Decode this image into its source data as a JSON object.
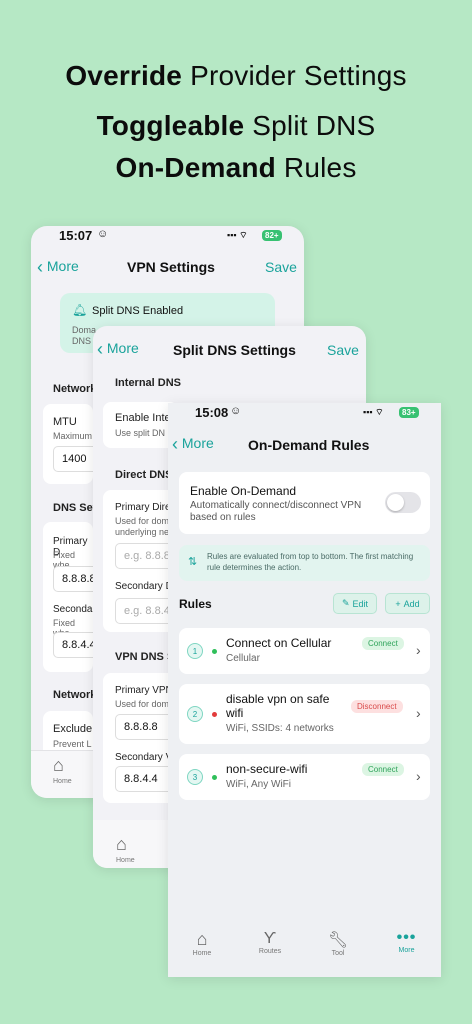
{
  "headline": {
    "line1_bold": "Override",
    "line1_rest": " Provider Settings",
    "line2_bold": "Toggleable",
    "line2_rest": " Split DNS",
    "line3_bold": "On-Demand",
    "line3_rest": " Rules"
  },
  "screen1": {
    "time": "15:07",
    "battery": "82+",
    "back": "More",
    "title": "VPN Settings",
    "action": "Save",
    "toast": {
      "text": "Split DNS Enabled",
      "sub1": "Doma",
      "sub2": "DNS"
    },
    "network_h": "Network",
    "mtu_label": "MTU",
    "mtu_sub": "Maximum",
    "mtu_value": "1400",
    "dns_h": "DNS Set",
    "primary_label": "Primary D",
    "primary_sub": "Fixed whe",
    "primary_value": "8.8.8.8",
    "secondary_label": "Seconda",
    "secondary_sub": "Fixed whe",
    "secondary_value": "8.8.4.4",
    "network2_h": "Network",
    "exclude_label": "Exclude",
    "exclude_sub": "Prevent L",
    "tab_home": "Home"
  },
  "screen2": {
    "back": "More",
    "title": "Split DNS Settings",
    "action": "Save",
    "internal_h": "Internal DNS",
    "enable_label": "Enable Inte",
    "enable_sub": "Use split DN",
    "direct_h": "Direct DNS",
    "primary_label": "Primary Dire",
    "primary_sub1": "Used for dom",
    "primary_sub2": "underlying ne",
    "primary_ph": "e.g. 8.8.8",
    "secondary_label": "Secondary D",
    "secondary_ph": "e.g. 8.8.4",
    "vpn_h": "VPN DNS S",
    "vpn_primary_label": "Primary VPN",
    "vpn_primary_sub": "Used for dom",
    "vpn_primary_value": "8.8.8.8",
    "vpn_secondary_label": "Secondary V",
    "vpn_secondary_value": "8.8.4.4",
    "tab_home": "Home"
  },
  "screen3": {
    "time": "15:08",
    "battery": "83+",
    "back": "More",
    "title": "On-Demand Rules",
    "enable_title": "Enable On-Demand",
    "enable_sub": "Automatically connect/disconnect VPN based on rules",
    "info": "Rules are evaluated from top to bottom. The first matching rule determines the action.",
    "rules_h": "Rules",
    "edit_label": "Edit",
    "add_label": "Add",
    "rules": [
      {
        "num": "1",
        "title": "Connect on Cellular",
        "sub": "Cellular",
        "action": "Connect",
        "dot_color": "#2fbf5a"
      },
      {
        "num": "2",
        "title": "disable vpn on safe wifi",
        "sub": "WiFi, SSIDs: 4 networks",
        "action": "Disconnect",
        "dot_color": "#e23b3b"
      },
      {
        "num": "3",
        "title": "non-secure-wifi",
        "sub": "WiFi, Any WiFi",
        "action": "Connect",
        "dot_color": "#2fbf5a"
      }
    ],
    "tabs": {
      "home": "Home",
      "routes": "Routes",
      "tool": "Tool",
      "more": "More"
    },
    "accent_color": "#1aa39b"
  }
}
